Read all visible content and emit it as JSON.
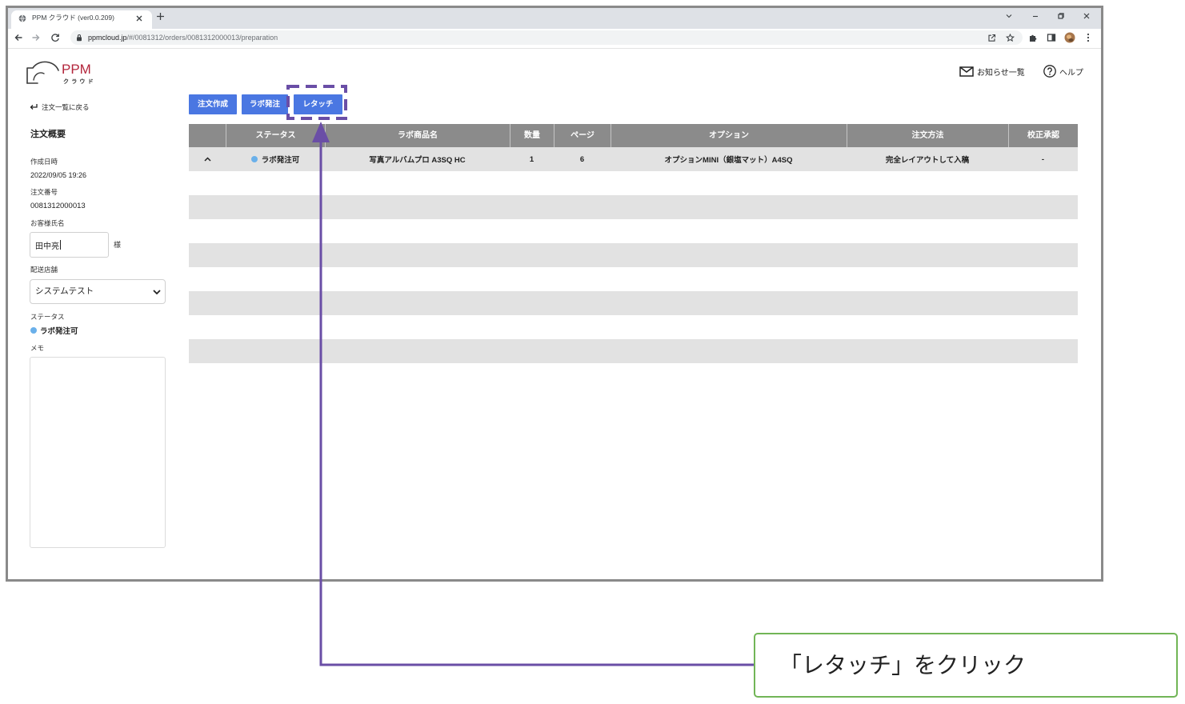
{
  "browser": {
    "tab": {
      "title": "PPM クラウド (ver0.0.209)",
      "icon": "globe-icon",
      "close_icon": "close-icon"
    },
    "new_tab_icon": "plus-icon",
    "window_controls": [
      "chevron-down-icon",
      "minimize-icon",
      "restore-icon",
      "close-icon"
    ],
    "nav_icons": [
      "back-icon",
      "forward-icon",
      "reload-icon"
    ],
    "url": {
      "host": "ppmcloud.jp",
      "path": "/#/0081312/orders/0081312000013/preparation",
      "icon": "lock-icon"
    },
    "toolbar_icons": [
      "share-icon",
      "star-icon",
      "extensions-icon",
      "side-panel-icon",
      "avatar",
      "menu-icon"
    ]
  },
  "header": {
    "logo": {
      "text": "PPM",
      "subtext": "クラウド"
    },
    "notices": {
      "label": "お知らせ一覧",
      "icon": "mail-icon"
    },
    "help": {
      "label": "ヘルプ",
      "icon": "help-icon"
    }
  },
  "sidebar": {
    "back": {
      "label": "注文一覧に戻る",
      "icon": "return-icon"
    },
    "title": "注文概要",
    "fields": {
      "created": {
        "label": "作成日時",
        "value": "2022/09/05 19:26"
      },
      "order_number": {
        "label": "注文番号",
        "value": "0081312000013"
      },
      "customer": {
        "label": "お客様氏名",
        "value": "田中亮",
        "suffix": "様"
      },
      "store": {
        "label": "配送店舗",
        "value": "システムテスト",
        "icon": "chevron-down-icon"
      },
      "status": {
        "label": "ステータス",
        "value": "ラボ発注可"
      },
      "memo": {
        "label": "メモ"
      }
    }
  },
  "actions": {
    "create_order": "注文作成",
    "lab_order": "ラボ発注",
    "retouch": "レタッチ"
  },
  "table": {
    "columns": [
      "ステータス",
      "ラボ商品名",
      "数量",
      "ページ",
      "オプション",
      "注文方法",
      "校正承認"
    ],
    "row_toggle_icon": "chevron-up-icon",
    "rows": [
      {
        "status": "ラボ発注可",
        "product": "写真アルバムプロ A3SQ HC",
        "quantity": "1",
        "pages": "6",
        "option": "オプションMINI（銀塩マット）A4SQ",
        "order_method": "完全レイアウトして入稿",
        "proof_approval": "-"
      }
    ]
  },
  "annotation": {
    "callout_text": "「レタッチ」をクリック"
  },
  "colors": {
    "accent": "#4a77e2",
    "status_ok": "#6ab0ea",
    "logo": "#b3263c",
    "annotation": "#6a4ea6",
    "callout_border": "#71b556",
    "table_header": "#8b8b8b",
    "row_alt": "#e2e2e2"
  }
}
